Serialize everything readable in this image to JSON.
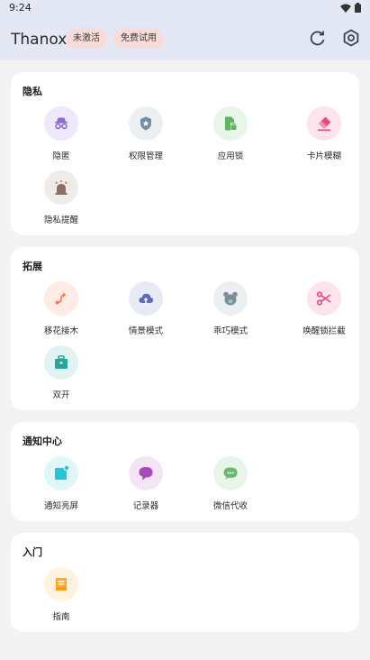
{
  "status_bar": {
    "time": "9:24"
  },
  "app_bar": {
    "title": "Thanox",
    "chip_unactivated": "未激活",
    "chip_free_trial": "免费试用"
  },
  "sections": {
    "privacy": {
      "title": "隐私",
      "items": [
        {
          "label": "隐匿",
          "icon": "incognito-icon",
          "color": "#8e6ad0",
          "bg": "#efe7fa"
        },
        {
          "label": "权限管理",
          "icon": "shield-star-icon",
          "color": "#6f8fa6",
          "bg": "#eceff1"
        },
        {
          "label": "应用锁",
          "icon": "app-lock-icon",
          "color": "#5cb85c",
          "bg": "#e8f5e9"
        },
        {
          "label": "卡片模糊",
          "icon": "eraser-icon",
          "color": "#e64b80",
          "bg": "#fde4ec"
        },
        {
          "label": "隐私提醒",
          "icon": "alarm-light-icon",
          "color": "#8d6e63",
          "bg": "#efebe9"
        }
      ]
    },
    "extensions": {
      "title": "拓展",
      "items": [
        {
          "label": "移花接木",
          "icon": "route-icon",
          "color": "#f07a50",
          "bg": "#fdebe4"
        },
        {
          "label": "情景模式",
          "icon": "cloud-upload-icon",
          "color": "#5c6bc0",
          "bg": "#e8eaf6"
        },
        {
          "label": "乖巧模式",
          "icon": "bear-icon",
          "color": "#78909c",
          "bg": "#eceff1"
        },
        {
          "label": "唤醒锁拦截",
          "icon": "scissors-icon",
          "color": "#e64b80",
          "bg": "#fde4ec"
        },
        {
          "label": "双开",
          "icon": "briefcase-icon",
          "color": "#26a69a",
          "bg": "#e0f2f1"
        }
      ]
    },
    "notification_center": {
      "title": "通知中心",
      "items": [
        {
          "label": "通知亮屏",
          "icon": "notification-screen-icon",
          "color": "#26c6da",
          "bg": "#e0f7fa"
        },
        {
          "label": "记录器",
          "icon": "chat-bubble-icon",
          "color": "#ab47bc",
          "bg": "#f3e5f5"
        },
        {
          "label": "微信代收",
          "icon": "wechat-icon",
          "color": "#66bb6a",
          "bg": "#e8f5e9"
        }
      ]
    },
    "getting_started": {
      "title": "入门",
      "items": [
        {
          "label": "指南",
          "icon": "book-icon",
          "color": "#ffa726",
          "bg": "#fff3e0"
        }
      ]
    }
  }
}
